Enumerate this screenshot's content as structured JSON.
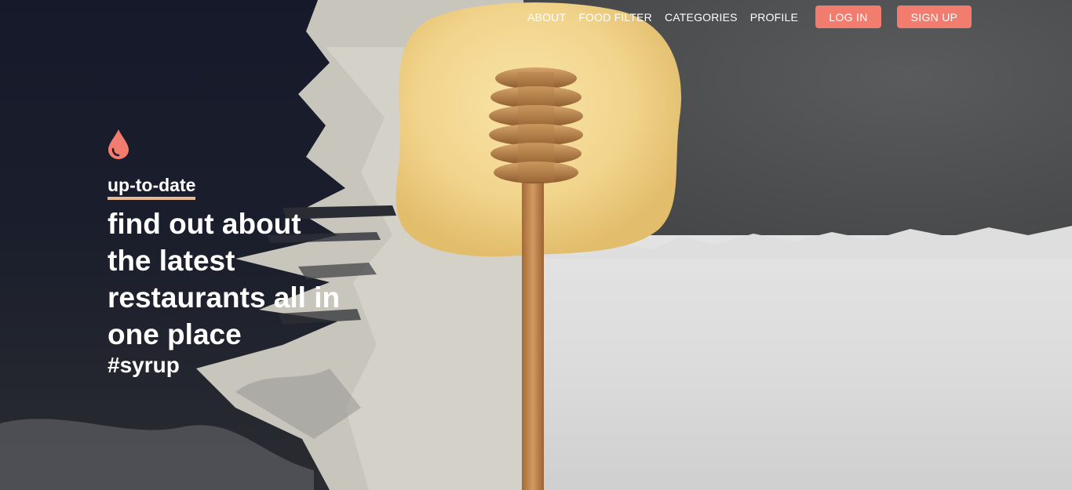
{
  "nav": {
    "links": [
      "ABOUT",
      "FOOD FILTER",
      "CATEGORIES",
      "PROFILE"
    ],
    "login_label": "LOG IN",
    "signup_label": "SIGN UP"
  },
  "hero": {
    "kicker": "up-to-date",
    "headline": "find out about the latest restaurants all in one place",
    "hashtag": "#syrup"
  },
  "colors": {
    "accent": "#f27c6d",
    "underline": "#e8b894",
    "honey": "#f2d58d",
    "dipper": "#b7804a"
  },
  "icons": {
    "hero_icon": "droplet-icon"
  }
}
